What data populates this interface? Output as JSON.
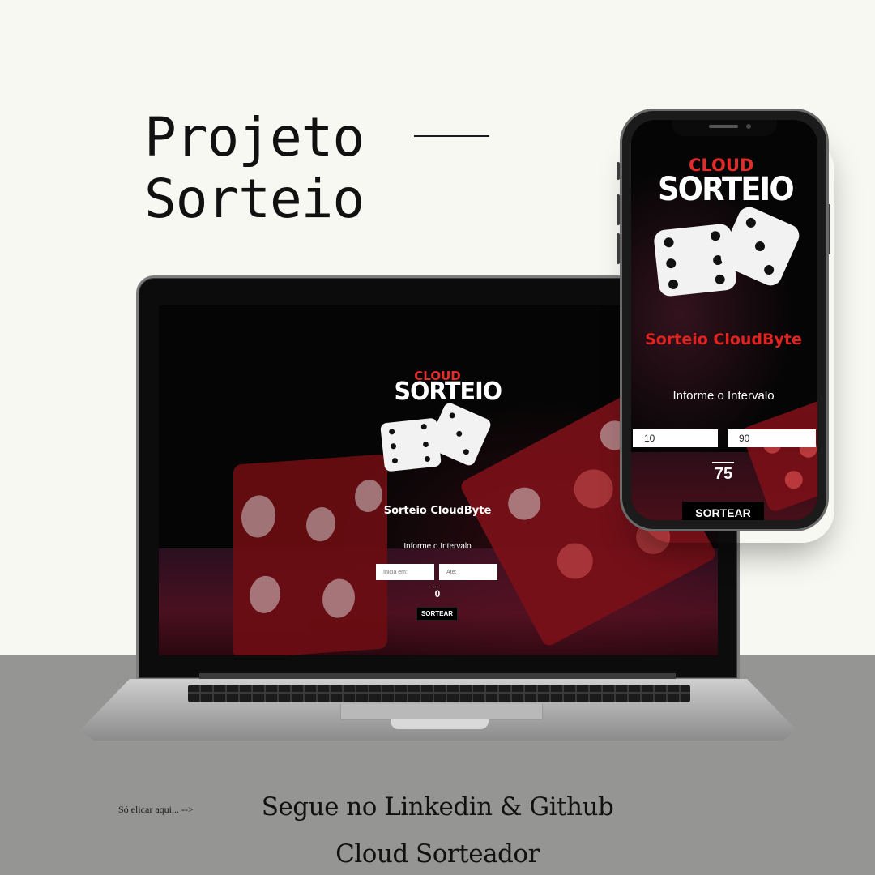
{
  "title": {
    "line1": "Projeto",
    "line2": "Sorteio"
  },
  "laptop_app": {
    "logo_cloud": "CLOUD",
    "logo_sorteio": "SORTEIO",
    "heading": "Sorteio CloudByte",
    "subheading": "Informe o Intervalo",
    "input_min_placeholder": "Inicia em:",
    "input_max_placeholder": "Até:",
    "result": "0",
    "draw_button": "SORTEAR"
  },
  "phone_app": {
    "logo_cloud": "CLOUD",
    "logo_sorteio": "SORTEIO",
    "heading": "Sorteio CloudByte",
    "subheading": "Informe o Intervalo",
    "input_min_value": "10",
    "input_max_value": "90",
    "result": "75",
    "draw_button": "SORTEAR"
  },
  "footer": {
    "click_hint": "Só elicar aqui... -->",
    "follow_text": "Segue no Linkedin & Github",
    "brand": "Cloud Sorteador"
  },
  "colors": {
    "background": "#f8f8f2",
    "bottom_band": "#959694",
    "accent_red": "#e0231f",
    "screen_black": "#050505"
  }
}
